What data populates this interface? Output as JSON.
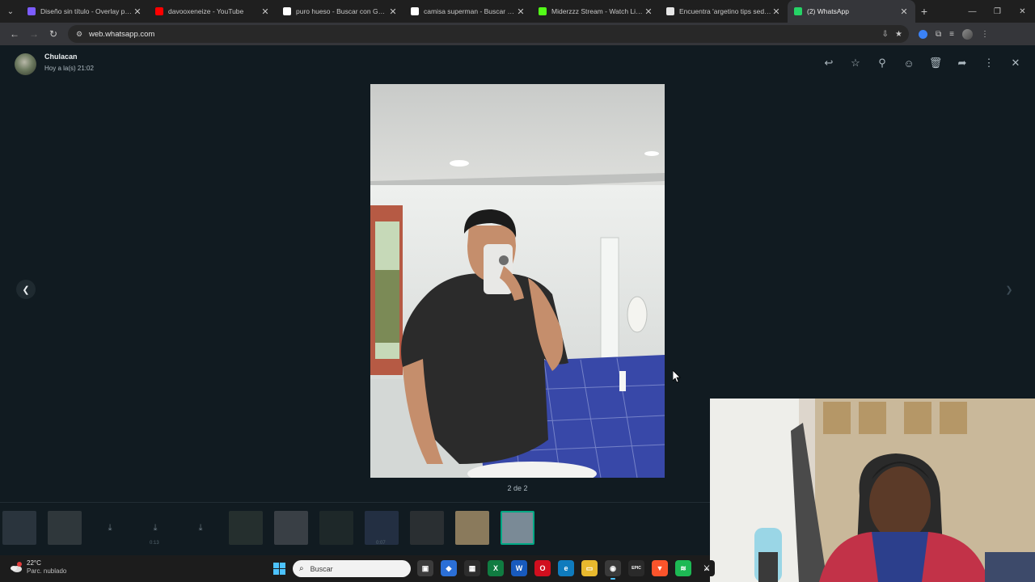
{
  "browser": {
    "tabs": [
      {
        "title": "Diseño sin título - Overlay para",
        "favicon_color": "#7c5cff",
        "active": false
      },
      {
        "title": "davooxeneize - YouTube",
        "favicon_color": "#ff0000",
        "active": false
      },
      {
        "title": "puro hueso - Buscar con Google",
        "favicon_color": "#ffffff",
        "active": false
      },
      {
        "title": "camisa superman - Buscar con",
        "favicon_color": "#ffffff",
        "active": false
      },
      {
        "title": "Miderzzz Stream - Watch Live o",
        "favicon_color": "#53fc18",
        "active": false
      },
      {
        "title": "Encuentra 'argetino tips seducc",
        "favicon_color": "#e6e6e6",
        "active": false
      },
      {
        "title": "(2) WhatsApp",
        "favicon_color": "#25d366",
        "active": true
      }
    ],
    "url": "web.whatsapp.com"
  },
  "viewer": {
    "sender_name": "Chulacan",
    "sent_time": "Hoy a la(s) 21:02",
    "counter": "2 de 2",
    "actions": [
      {
        "name": "reply-icon",
        "glyph": "↩"
      },
      {
        "name": "star-icon",
        "glyph": "☆"
      },
      {
        "name": "pin-icon",
        "glyph": "⚲"
      },
      {
        "name": "emoji-icon",
        "glyph": "☺"
      },
      {
        "name": "delete-icon",
        "glyph": "🗑"
      },
      {
        "name": "forward-icon",
        "glyph": "➦"
      },
      {
        "name": "more-options-icon",
        "glyph": "⋮"
      },
      {
        "name": "close-icon",
        "glyph": "✕"
      }
    ],
    "thumbnails": [
      {
        "kind": "image",
        "color": "#4a5560",
        "time": ""
      },
      {
        "kind": "image",
        "color": "#555a5c",
        "time": ""
      },
      {
        "kind": "download",
        "color": "",
        "time": ""
      },
      {
        "kind": "download",
        "color": "",
        "time": "0:13"
      },
      {
        "kind": "download",
        "color": "",
        "time": ""
      },
      {
        "kind": "image",
        "color": "#3d4a3f",
        "time": ""
      },
      {
        "kind": "image",
        "color": "#6a6d70",
        "time": ""
      },
      {
        "kind": "image",
        "color": "#2f3a34",
        "time": ""
      },
      {
        "kind": "image",
        "color": "#3a4a6a",
        "time": "0:07"
      },
      {
        "kind": "image",
        "color": "#4a4a48",
        "time": ""
      },
      {
        "kind": "image",
        "color": "#8a7a5c",
        "time": ""
      },
      {
        "kind": "image",
        "color": "#7a8a96",
        "time": ""
      }
    ]
  },
  "taskbar": {
    "temperature": "22°C",
    "condition": "Parc. nublado",
    "weather_badge": "3",
    "search_placeholder": "Buscar",
    "apps": [
      {
        "name": "task-view-icon",
        "label": "▣",
        "bg": "#3c3c3c"
      },
      {
        "name": "copilot-icon",
        "label": "◆",
        "bg": "#2b6fd6"
      },
      {
        "name": "store-icon",
        "label": "▦",
        "bg": "#2d2d2d"
      },
      {
        "name": "excel-icon",
        "label": "X",
        "bg": "#107c41"
      },
      {
        "name": "word-icon",
        "label": "W",
        "bg": "#185abd"
      },
      {
        "name": "opera-icon",
        "label": "O",
        "bg": "#d10e1e"
      },
      {
        "name": "edge-icon",
        "label": "e",
        "bg": "#0f7bbd"
      },
      {
        "name": "file-explorer-icon",
        "label": "▭",
        "bg": "#e8b92e"
      },
      {
        "name": "chrome-icon",
        "label": "◉",
        "bg": "#3a3a3a"
      },
      {
        "name": "epic-games-icon",
        "label": "EPIC",
        "bg": "#2a2a2a"
      },
      {
        "name": "brave-icon",
        "label": "▼",
        "bg": "#fb542b"
      },
      {
        "name": "spotify-icon",
        "label": "≋",
        "bg": "#1db954"
      },
      {
        "name": "extra-app-icon",
        "label": "⚔",
        "bg": "#1c1c1c"
      }
    ]
  }
}
